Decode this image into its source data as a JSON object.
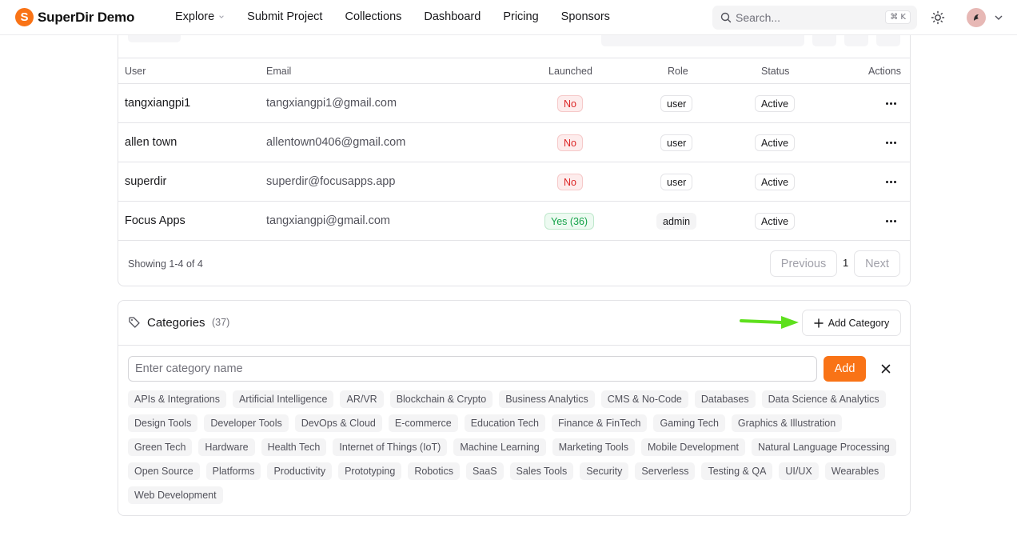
{
  "brand": {
    "logo_letter": "S",
    "name": "SuperDir Demo",
    "accent": "#f97316"
  },
  "nav": [
    {
      "label": "Explore",
      "has_dropdown": true
    },
    {
      "label": "Submit Project"
    },
    {
      "label": "Collections"
    },
    {
      "label": "Dashboard"
    },
    {
      "label": "Pricing"
    },
    {
      "label": "Sponsors"
    }
  ],
  "search": {
    "placeholder": "Search...",
    "shortcut": "⌘ K"
  },
  "users_table": {
    "columns": {
      "user": "User",
      "email": "Email",
      "launched": "Launched",
      "role": "Role",
      "status": "Status",
      "actions": "Actions"
    },
    "rows": [
      {
        "user": "tangxiangpi1",
        "email": "tangxiangpi1@gmail.com",
        "launched": "No",
        "role": "user",
        "status": "Active"
      },
      {
        "user": "allen town",
        "email": "allentown0406@gmail.com",
        "launched": "No",
        "role": "user",
        "status": "Active"
      },
      {
        "user": "superdir",
        "email": "superdir@focusapps.app",
        "launched": "No",
        "role": "user",
        "status": "Active"
      },
      {
        "user": "Focus Apps",
        "email": "tangxiangpi@gmail.com",
        "launched": "Yes (36)",
        "role": "admin",
        "status": "Active"
      }
    ],
    "footer": {
      "showing": "Showing 1-4 of 4",
      "previous": "Previous",
      "page": "1",
      "next": "Next"
    }
  },
  "categories": {
    "title": "Categories",
    "count": "(37)",
    "add_button": "Add Category",
    "input_placeholder": "Enter category name",
    "submit_label": "Add",
    "items": [
      "APIs & Integrations",
      "Artificial Intelligence",
      "AR/VR",
      "Blockchain & Crypto",
      "Business Analytics",
      "CMS & No-Code",
      "Databases",
      "Data Science & Analytics",
      "Design Tools",
      "Developer Tools",
      "DevOps & Cloud",
      "E-commerce",
      "Education Tech",
      "Finance & FinTech",
      "Gaming Tech",
      "Graphics & Illustration",
      "Green Tech",
      "Hardware",
      "Health Tech",
      "Internet of Things (IoT)",
      "Machine Learning",
      "Marketing Tools",
      "Mobile Development",
      "Natural Language Processing",
      "Open Source",
      "Platforms",
      "Productivity",
      "Prototyping",
      "Robotics",
      "SaaS",
      "Sales Tools",
      "Security",
      "Serverless",
      "Testing & QA",
      "UI/UX",
      "Wearables",
      "Web Development"
    ]
  },
  "annotation_color": "#5ee01d"
}
